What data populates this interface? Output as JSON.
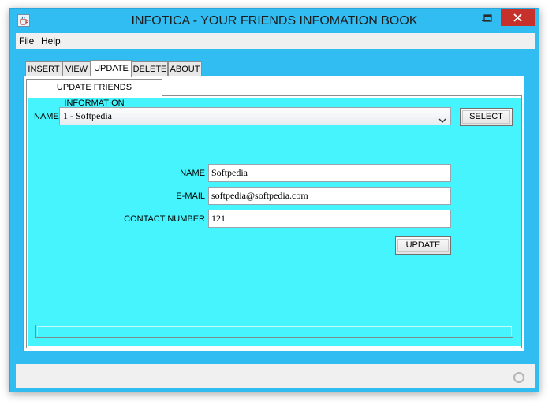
{
  "window": {
    "title": "INFOTICA - YOUR FRIENDS INFOMATION BOOK"
  },
  "menu": {
    "file": "File",
    "help": "Help"
  },
  "tabs": [
    "INSERT",
    "VIEW",
    "UPDATE",
    "DELETE",
    "ABOUT"
  ],
  "active_tab": "UPDATE",
  "subtab": {
    "label": "UPDATE FRIENDS INFORMATION"
  },
  "form": {
    "select_label": "NAME",
    "select_value": "1 - Softpedia",
    "select_button": "SELECT",
    "name_label": "NAME",
    "name_value": "Softpedia",
    "email_label": "E-MAIL",
    "email_value": "softpedia@softpedia.com",
    "contact_label": "CONTACT NUMBER",
    "contact_value": "121",
    "update_button": "UPDATE"
  },
  "colors": {
    "window_frame": "#32bdf2",
    "panel_bg": "#45f4fc",
    "close_button": "#c7312b"
  },
  "icons": {
    "app": "java-cup-icon",
    "minimize": "minimize-icon",
    "maximize": "maximize-icon",
    "close": "close-icon",
    "dropdown": "chevron-down-icon",
    "status": "busy-indicator-icon"
  }
}
